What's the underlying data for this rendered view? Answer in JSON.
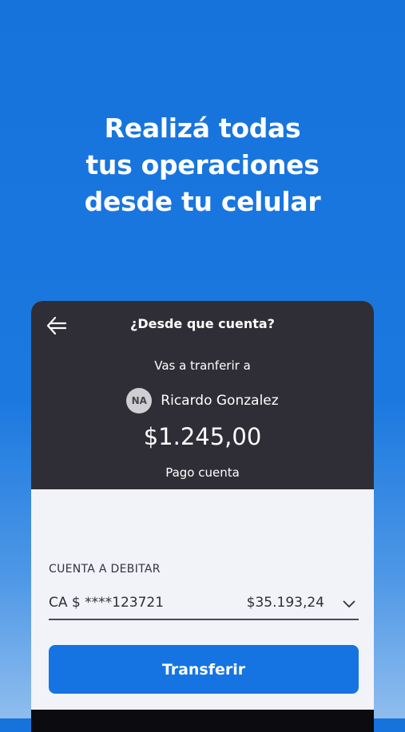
{
  "headline": {
    "lines": [
      "Realizá todas",
      "tus operaciones",
      "desde tu celular"
    ]
  },
  "card": {
    "header": {
      "back_icon": "arrow-left-icon",
      "title": "¿Desde que cuenta?"
    },
    "transfer_to_label": "Vas a tranferir a",
    "recipient": {
      "initials": "NA",
      "name": "Ricardo Gonzalez"
    },
    "amount": "$1.245,00",
    "concept": "Pago cuenta",
    "debit_account": {
      "label": "CUENTA A DEBITAR",
      "account": "CA $ ****123721",
      "balance": "$35.193,24",
      "dropdown_icon": "chevron-down-icon"
    },
    "transfer_button": "Transferir"
  },
  "colors": {
    "background": "#1673dc",
    "card_header": "#2f2e36",
    "card_body": "#f2f3f8",
    "primary_button": "#1574e1"
  }
}
